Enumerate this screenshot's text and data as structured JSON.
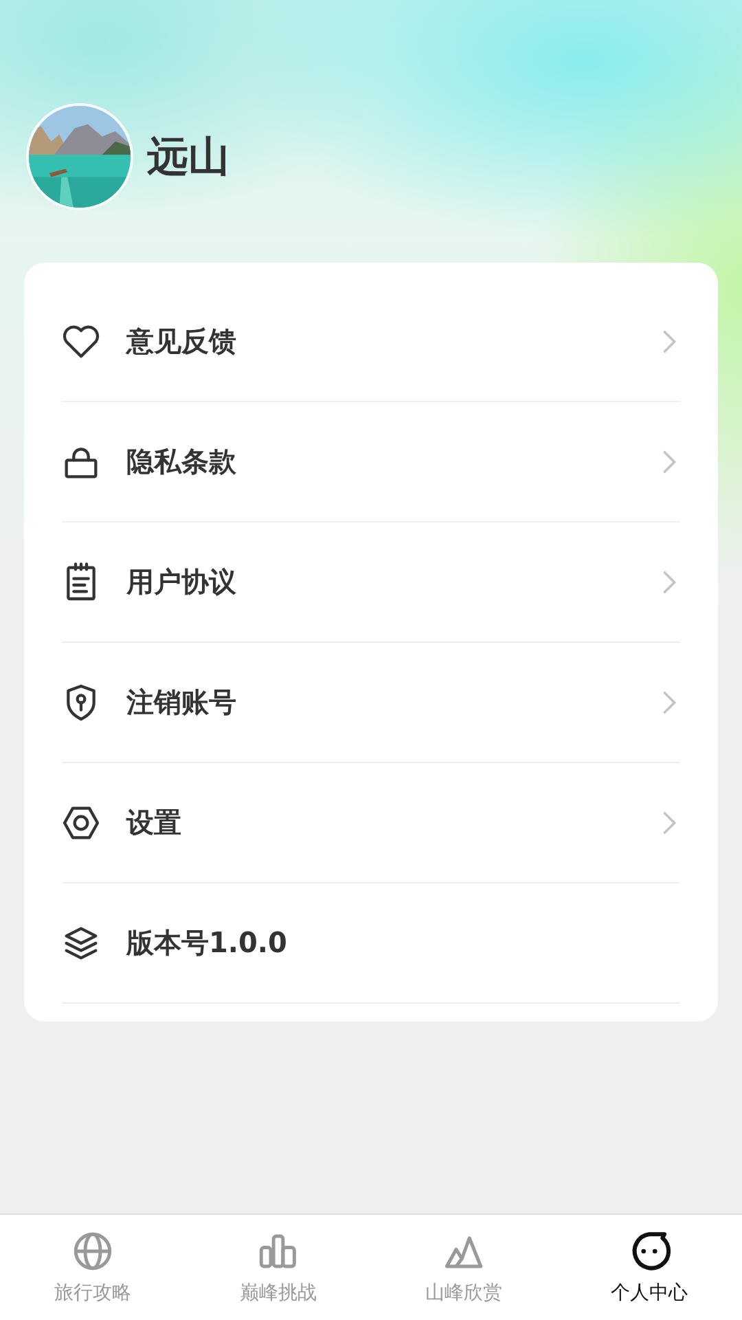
{
  "profile": {
    "name": "远山"
  },
  "menu": [
    {
      "label": "意见反馈",
      "chevron": true
    },
    {
      "label": "隐私条款",
      "chevron": true
    },
    {
      "label": "用户协议",
      "chevron": true
    },
    {
      "label": "注销账号",
      "chevron": true
    },
    {
      "label": "设置",
      "chevron": true
    },
    {
      "label": "版本号1.0.0",
      "chevron": false
    }
  ],
  "tab_bar": [
    {
      "label": "旅行攻略",
      "selected": false
    },
    {
      "label": "巅峰挑战",
      "selected": false
    },
    {
      "label": "山峰欣赏",
      "selected": false
    },
    {
      "label": "个人中心",
      "selected": true
    }
  ]
}
